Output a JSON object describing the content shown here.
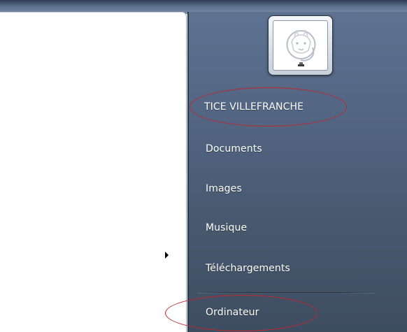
{
  "start_menu": {
    "right_pane": {
      "user_name": "TICE VILLEFRANCHE",
      "items": [
        {
          "label": "Documents"
        },
        {
          "label": "Images"
        },
        {
          "label": "Musique"
        },
        {
          "label": "Téléchargements"
        },
        {
          "label": "Ordinateur"
        }
      ]
    },
    "avatar_icon": "user-avatar-icon",
    "submenu_arrow_icon": "arrow-right-icon",
    "annotation_color": "#c0262c"
  }
}
